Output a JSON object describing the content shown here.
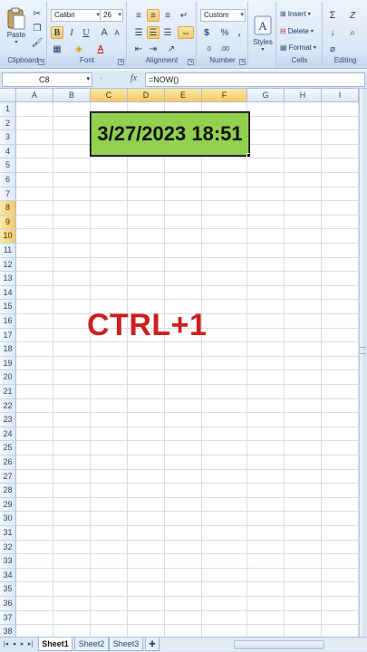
{
  "ribbon": {
    "clipboard": {
      "paste_label": "Paste",
      "group_label": "Clipboard"
    },
    "font": {
      "font_name": "Calibri",
      "font_size": "26",
      "bold": "B",
      "italic": "I",
      "underline": "U",
      "grow": "A",
      "shrink": "A",
      "font_color": "A",
      "group_label": "Font"
    },
    "alignment": {
      "group_label": "Alignment"
    },
    "number": {
      "format": "Custom",
      "currency": "$",
      "percent": "%",
      "comma": ",",
      "group_label": "Number"
    },
    "styles": {
      "label": "Styles"
    },
    "cells": {
      "insert": "Insert",
      "delete": "Delete",
      "format": "Format",
      "group_label": "Cells"
    },
    "editing": {
      "sum": "Σ",
      "sort": "Z",
      "fill": "↓",
      "clear": "⌀",
      "group_label": "Editing"
    }
  },
  "formula_bar": {
    "name_box": "C8",
    "fx": "fx",
    "formula": "=NOW()"
  },
  "columns": [
    "A",
    "B",
    "C",
    "D",
    "E",
    "F",
    "G",
    "H",
    "I"
  ],
  "selected_columns": [
    "C",
    "D",
    "E",
    "F"
  ],
  "rows": [
    "1",
    "2",
    "3",
    "4",
    "5",
    "6",
    "7",
    "8",
    "9",
    "10",
    "11",
    "12",
    "13",
    "14",
    "15",
    "16",
    "17",
    "18",
    "19",
    "20",
    "21",
    "22",
    "23",
    "24",
    "25",
    "26",
    "27",
    "28",
    "29",
    "30",
    "31",
    "32",
    "33",
    "34",
    "35",
    "36",
    "37",
    "38"
  ],
  "selected_rows": [
    "8",
    "9",
    "10"
  ],
  "cell_value": "3/27/2023 18:51",
  "overlay_text": "CTRL+1",
  "sheets": [
    {
      "name": "Sheet1",
      "active": true
    },
    {
      "name": "Sheet2",
      "active": false
    },
    {
      "name": "Sheet3",
      "active": false
    }
  ],
  "colors": {
    "cell_fill": "#92d050",
    "overlay_text": "#cc1f1f",
    "selection_header": "#f7c866"
  }
}
